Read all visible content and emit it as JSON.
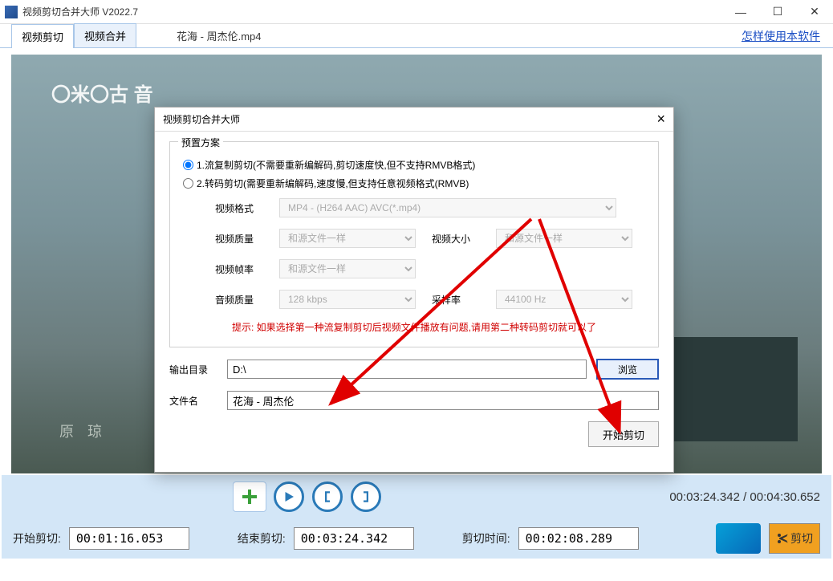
{
  "window": {
    "title": "视频剪切合并大师 V2022.7"
  },
  "tabs": {
    "cut": "视频剪切",
    "merge": "视频合并"
  },
  "top_filename": "花海 - 周杰伦.mp4",
  "help_link": "怎样使用本软件",
  "watermark": {
    "top": "〇米〇古 音",
    "bottom": "原 琼"
  },
  "controls": {
    "time_display": "00:03:24.342 / 00:04:30.652"
  },
  "bottom": {
    "start_label": "开始剪切:",
    "start_value": "00:01:16.053",
    "end_label": "结束剪切:",
    "end_value": "00:03:24.342",
    "duration_label": "剪切时间:",
    "duration_value": "00:02:08.289",
    "cut_button": "剪切"
  },
  "dialog": {
    "title": "视频剪切合并大师",
    "preset_label": "预置方案",
    "opt1": "1.流复制剪切(不需要重新编解码,剪切速度快,但不支持RMVB格式)",
    "opt2": "2.转码剪切(需要重新编解码,速度慢,但支持任意视频格式(RMVB)",
    "labels": {
      "vformat": "视频格式",
      "vquality": "视频质量",
      "vsize": "视频大小",
      "vfps": "视频帧率",
      "aquality": "音频质量",
      "srate": "采样率"
    },
    "values": {
      "vformat": "MP4 - (H264 AAC) AVC(*.mp4)",
      "vquality": "和源文件一样",
      "vsize": "和源文件一样",
      "vfps": "和源文件一样",
      "aquality": "128 kbps",
      "srate": "44100 Hz"
    },
    "hint": "提示: 如果选择第一种流复制剪切后视频文件播放有问题,请用第二种转码剪切就可以了",
    "out_dir_label": "输出目录",
    "out_dir_value": "D:\\",
    "browse": "浏览",
    "filename_label": "文件名",
    "filename_value": "花海 - 周杰伦",
    "start_button": "开始剪切"
  }
}
